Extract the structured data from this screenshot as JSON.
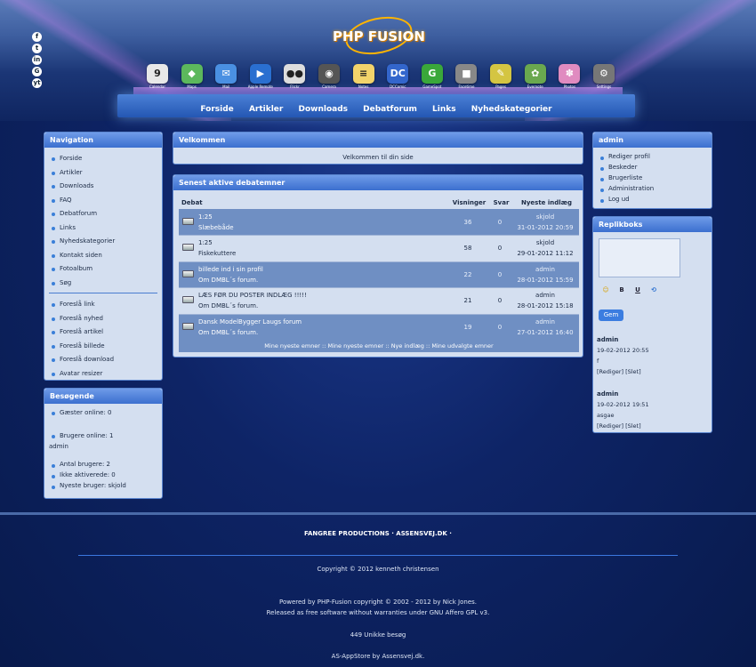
{
  "header": {
    "logo_text": "PHP FUSION",
    "social": [
      "f",
      "t",
      "in",
      "G",
      "yt"
    ],
    "apps": [
      {
        "label": "Calendar",
        "icon": "9",
        "color": "#e8e8e8"
      },
      {
        "label": "Maps",
        "icon": "◆",
        "color": "#5cb85c"
      },
      {
        "label": "Mail",
        "icon": "✉",
        "color": "#4a90e2"
      },
      {
        "label": "Apple Remote",
        "icon": "▶",
        "color": "#2a6fd0"
      },
      {
        "label": "Flickr",
        "icon": "●●",
        "color": "#ddd"
      },
      {
        "label": "Camera",
        "icon": "◉",
        "color": "#555"
      },
      {
        "label": "Notes",
        "icon": "≡",
        "color": "#f2d36b"
      },
      {
        "label": "DCComic",
        "icon": "DC",
        "color": "#3366cc"
      },
      {
        "label": "GameSpot",
        "icon": "G",
        "color": "#3aa83a"
      },
      {
        "label": "Facetime",
        "icon": "■",
        "color": "#888"
      },
      {
        "label": "Pages",
        "icon": "✎",
        "color": "#d4c542"
      },
      {
        "label": "Evernote",
        "icon": "✿",
        "color": "#6aa84f"
      },
      {
        "label": "Photos",
        "icon": "✽",
        "color": "#e08bc0"
      },
      {
        "label": "Settings",
        "icon": "⚙",
        "color": "#777"
      }
    ],
    "nav": [
      "Forside",
      "Artikler",
      "Downloads",
      "Debatforum",
      "Links",
      "Nyhedskategorier"
    ]
  },
  "navigation": {
    "title": "Navigation",
    "items": [
      "Forside",
      "Artikler",
      "Downloads",
      "FAQ",
      "Debatforum",
      "Links",
      "Nyhedskategorier",
      "Kontakt siden",
      "Fotoalbum",
      "Søg"
    ],
    "items2": [
      "Foreslå link",
      "Foreslå nyhed",
      "Foreslå artikel",
      "Foreslå billede",
      "Foreslå download",
      "Avatar resizer"
    ]
  },
  "visitors": {
    "title": "Besøgende",
    "guests": "Gæster online: 0",
    "members": "Brugere online: 1",
    "member_name": "admin",
    "total": "Antal brugere: 2",
    "inactive": "Ikke aktiverede: 0",
    "newest": "Nyeste bruger: skjold"
  },
  "welcome": {
    "title": "Velkommen",
    "text": "Velkommen til din side"
  },
  "forum": {
    "title": "Senest aktive debatemner",
    "columns": [
      "Debat",
      "Visninger",
      "Svar",
      "Nyeste indlæg"
    ],
    "rows": [
      {
        "topic": "1:25",
        "forum": "Slæbebåde",
        "views": "36",
        "replies": "0",
        "user": "skjold",
        "date": "31-01-2012 20:59"
      },
      {
        "topic": "1:25",
        "forum": "Fiskekuttere",
        "views": "58",
        "replies": "0",
        "user": "skjold",
        "date": "29-01-2012 11:12"
      },
      {
        "topic": "billede ind i sin profil",
        "forum": "Om DMBL´s forum.",
        "views": "22",
        "replies": "0",
        "user": "admin",
        "date": "28-01-2012 15:59"
      },
      {
        "topic": "LÆS FØR DU POSTER INDLÆG !!!!!",
        "forum": "Om DMBL´s forum.",
        "views": "21",
        "replies": "0",
        "user": "admin",
        "date": "28-01-2012 15:18"
      },
      {
        "topic": "Dansk ModelBygger Laugs forum",
        "forum": "Om DMBL´s forum.",
        "views": "19",
        "replies": "0",
        "user": "admin",
        "date": "27-01-2012 16:40"
      }
    ],
    "footer": "Mine nyeste emner :: Mine nyeste emner :: Nye indlæg :: Mine udvalgte emner"
  },
  "admin": {
    "title": "admin",
    "items": [
      "Rediger profil",
      "Beskeder",
      "Brugerliste",
      "Administration",
      "Log ud"
    ]
  },
  "shoutbox": {
    "title": "Replikboks",
    "format": [
      "☺",
      "B",
      "U",
      "⟲"
    ],
    "button": "Gem",
    "messages": [
      {
        "user": "admin",
        "date": "19-02-2012 20:55",
        "text": "f",
        "actions": "[Rediger] [Slet]"
      },
      {
        "user": "admin",
        "date": "19-02-2012 19:51",
        "text": "asgae",
        "actions": "[Rediger] [Slet]"
      }
    ]
  },
  "footer": {
    "links": "FANGREE PRODUCTIONS   ·   ASSENSVEJ.DK   ·",
    "copyright": "Copyright © 2012 kenneth christensen",
    "powered1": "Powered by PHP-Fusion copyright © 2002 - 2012 by Nick Jones.",
    "powered2": "Released as free software without warranties under GNU Affero GPL v3.",
    "visits": "449 Unikke besøg",
    "appstore": "AS-AppStore by Assensvej.dk."
  }
}
